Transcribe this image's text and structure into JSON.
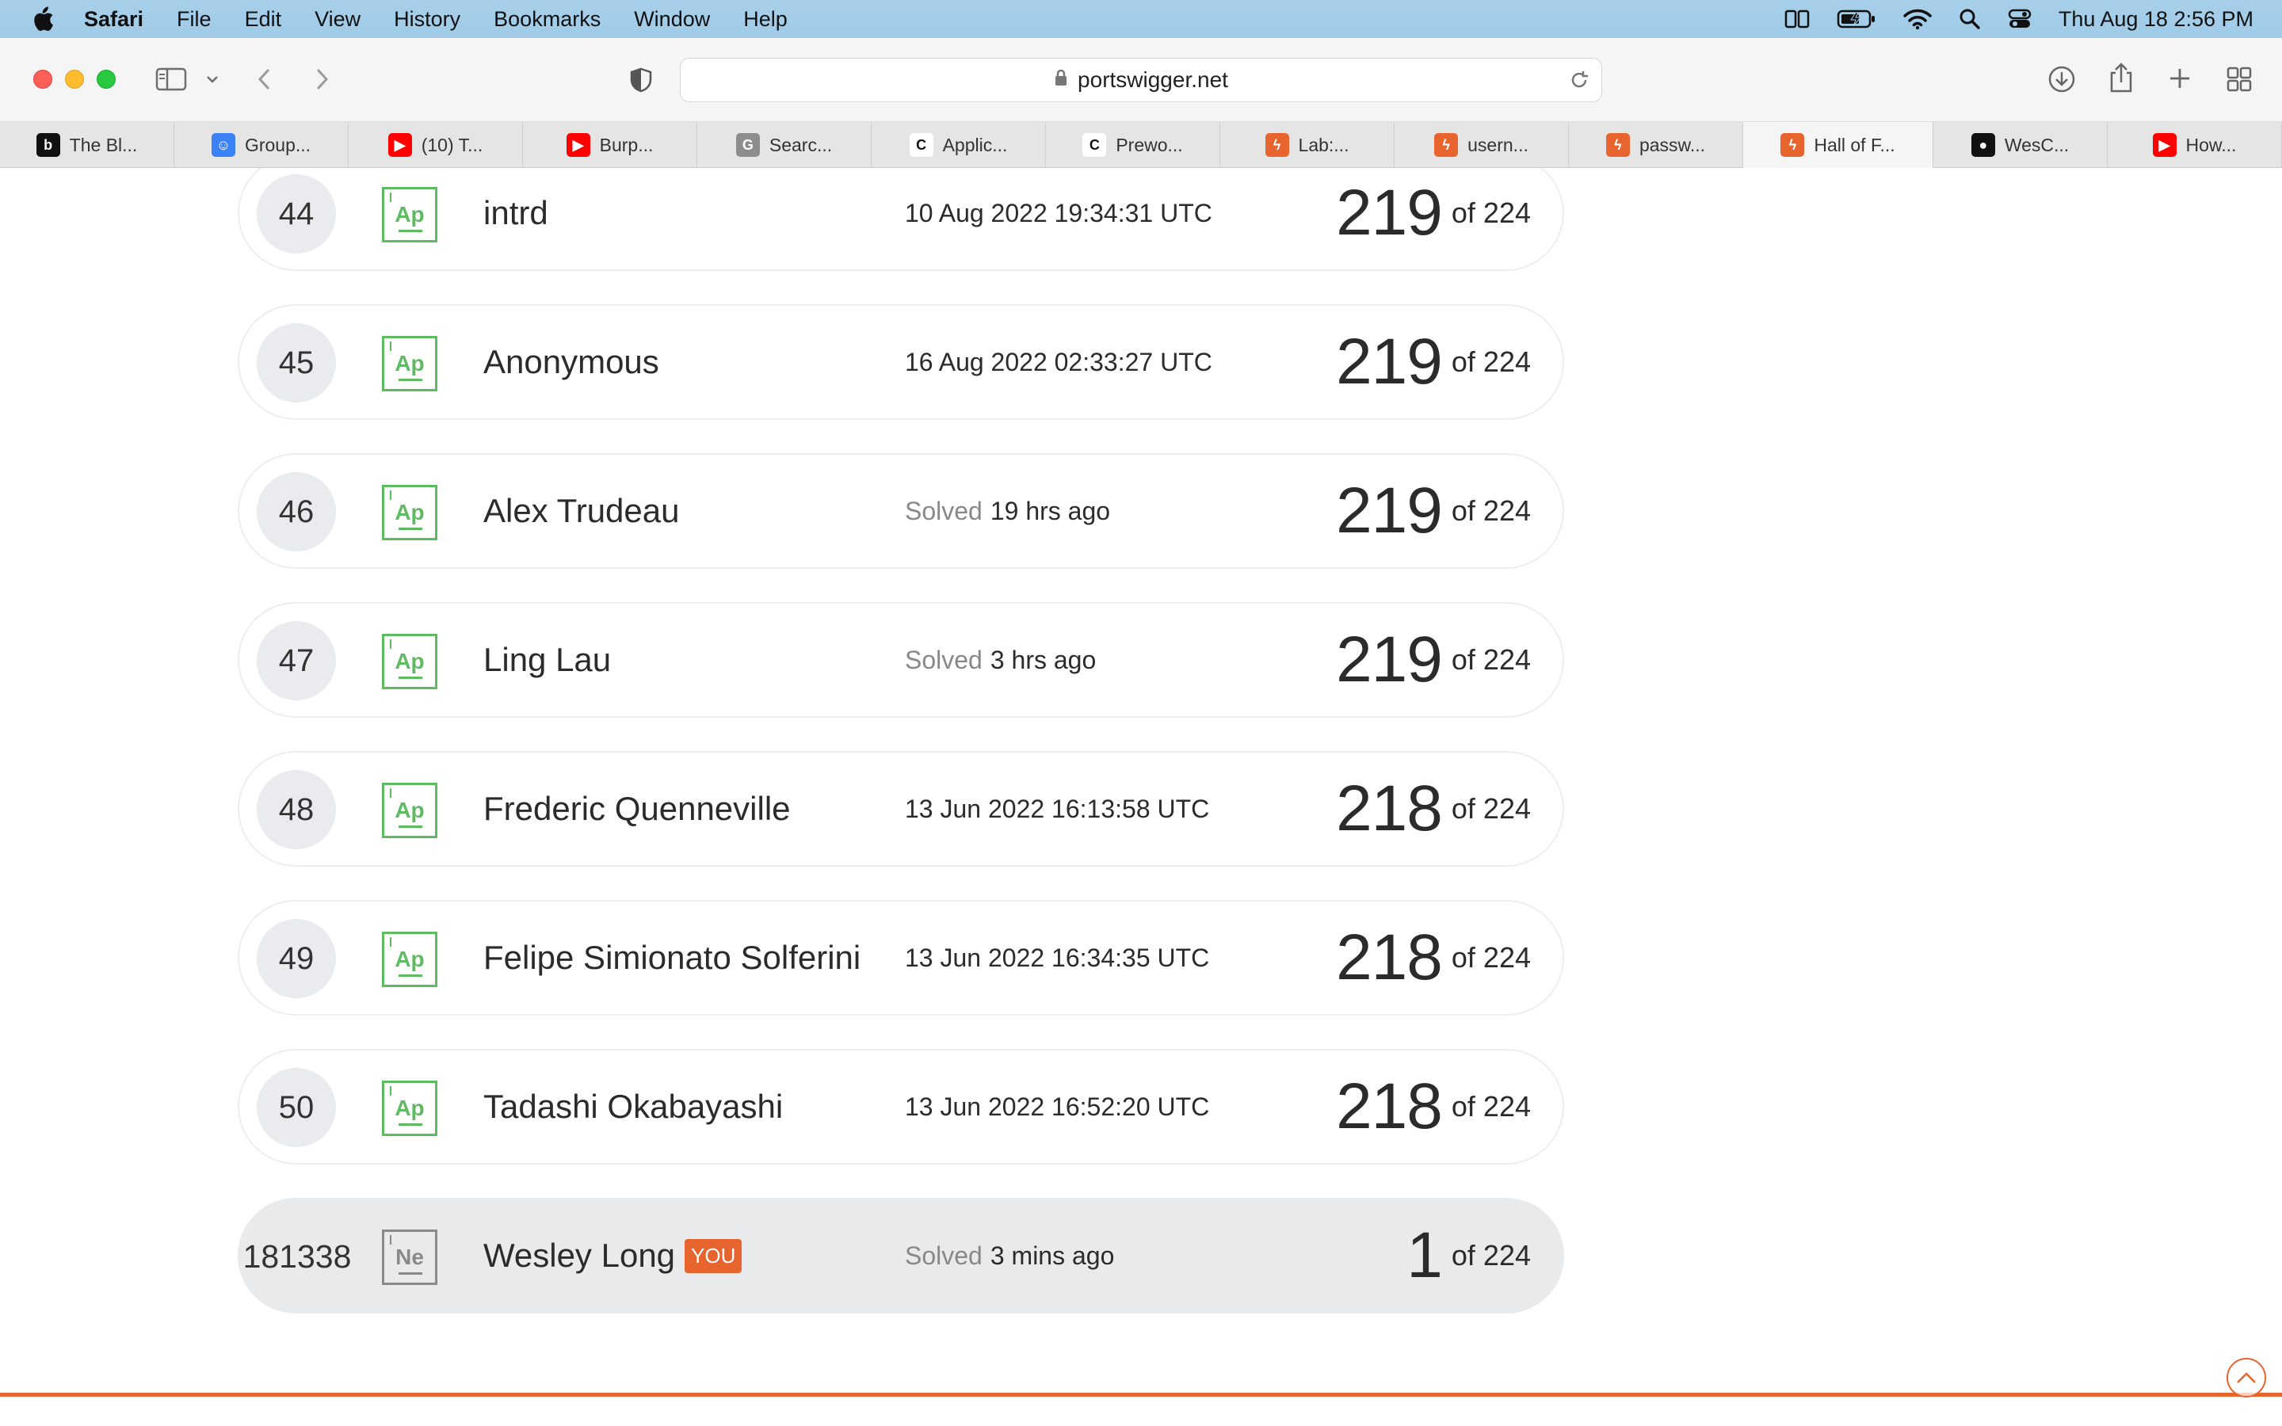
{
  "menubar": {
    "app": "Safari",
    "items": [
      "File",
      "Edit",
      "View",
      "History",
      "Bookmarks",
      "Window",
      "Help"
    ],
    "clock": "Thu Aug 18  2:56 PM"
  },
  "browser": {
    "url": "portswigger.net",
    "tabs": [
      {
        "label": "The Bl...",
        "icon": "bc-icon",
        "color": "#111111",
        "glyph": "b"
      },
      {
        "label": "Group...",
        "icon": "chat-icon",
        "color": "#3b82f6",
        "glyph": "☺"
      },
      {
        "label": "(10) T...",
        "icon": "youtube-icon",
        "color": "#ff0000",
        "glyph": "▶"
      },
      {
        "label": "Burp...",
        "icon": "youtube-icon",
        "color": "#ff0000",
        "glyph": "▶"
      },
      {
        "label": "Searc...",
        "icon": "g-icon",
        "color": "#8d8d8d",
        "glyph": "G"
      },
      {
        "label": "Applic...",
        "icon": "c-icon",
        "color": "#ffffff",
        "glyph": "C"
      },
      {
        "label": "Prewo...",
        "icon": "c-icon",
        "color": "#ffffff",
        "glyph": "C"
      },
      {
        "label": "Lab:...",
        "icon": "portswigger-icon",
        "color": "#e8642e",
        "glyph": "ϟ"
      },
      {
        "label": "usern...",
        "icon": "portswigger-icon",
        "color": "#e8642e",
        "glyph": "ϟ"
      },
      {
        "label": "passw...",
        "icon": "portswigger-icon",
        "color": "#e8642e",
        "glyph": "ϟ"
      },
      {
        "label": "Hall of F...",
        "icon": "portswigger-icon",
        "color": "#e8642e",
        "glyph": "ϟ",
        "active": true
      },
      {
        "label": "WesC...",
        "icon": "github-icon",
        "color": "#111111",
        "glyph": "●"
      },
      {
        "label": "How...",
        "icon": "youtube-icon",
        "color": "#ff0000",
        "glyph": "▶"
      }
    ]
  },
  "leaderboard": {
    "total_label": "of 224",
    "solved_prefix": "Solved",
    "you_badge": "YOU",
    "rows": [
      {
        "rank": "44",
        "level": "Ap",
        "name": "intrd",
        "date": "10 Aug 2022 19:34:31 UTC",
        "score": "219"
      },
      {
        "rank": "45",
        "level": "Ap",
        "name": "Anonymous",
        "date": "16 Aug 2022 02:33:27 UTC",
        "score": "219"
      },
      {
        "rank": "46",
        "level": "Ap",
        "name": "Alex Trudeau",
        "solved": "19 hrs ago",
        "score": "219"
      },
      {
        "rank": "47",
        "level": "Ap",
        "name": "Ling Lau",
        "solved": "3 hrs ago",
        "score": "219"
      },
      {
        "rank": "48",
        "level": "Ap",
        "name": "Frederic Quenneville",
        "date": "13 Jun 2022 16:13:58 UTC",
        "score": "218"
      },
      {
        "rank": "49",
        "level": "Ap",
        "name": "Felipe Simionato Solferini",
        "date": "13 Jun 2022 16:34:35 UTC",
        "score": "218"
      },
      {
        "rank": "50",
        "level": "Ap",
        "name": "Tadashi Okabayashi",
        "date": "13 Jun 2022 16:52:20 UTC",
        "score": "218"
      },
      {
        "rank": "181338",
        "level": "Ne",
        "name": "Wesley Long",
        "solved": "3 mins ago",
        "score": "1",
        "you": true
      }
    ]
  }
}
